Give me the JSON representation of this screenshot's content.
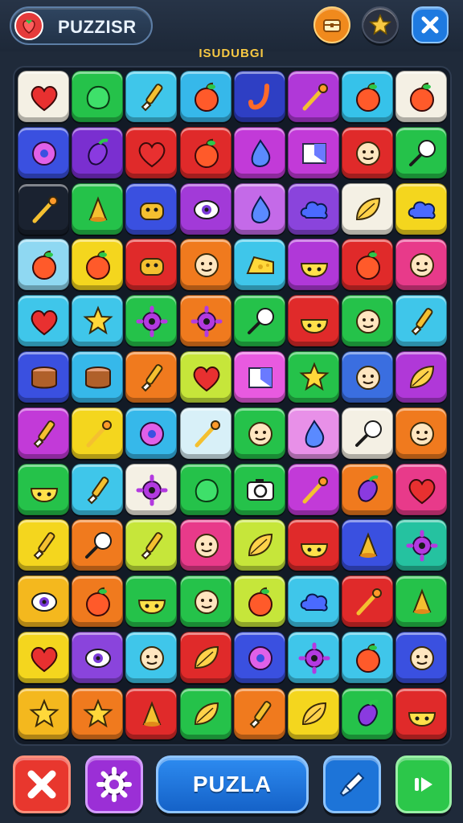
{
  "header": {
    "title": "PUZZISR",
    "logo_icon": "strawberry-icon",
    "buttons": [
      {
        "name": "menu-button",
        "icon": "chest-icon",
        "color": "#f08a1d"
      },
      {
        "name": "star-button",
        "icon": "star-icon",
        "color": "#2b3140"
      },
      {
        "name": "close-button",
        "icon": "close-icon",
        "color": "#1e7ae0"
      }
    ]
  },
  "board": {
    "label": "ISUDUBGI",
    "rows": 12,
    "columns": 8,
    "tiles": [
      [
        {
          "c": "#f4f0e4",
          "i": "heart"
        },
        {
          "c": "#25c24a",
          "i": "blob"
        },
        {
          "c": "#3fc6ea",
          "i": "brush"
        },
        {
          "c": "#36b8ea",
          "i": "apple"
        },
        {
          "c": "#2e3fc4",
          "i": "hook"
        },
        {
          "c": "#b038d8",
          "i": "wand"
        },
        {
          "c": "#36c2ea",
          "i": "apple"
        },
        {
          "c": "#f4f0e4",
          "i": "apple"
        }
      ],
      [
        {
          "c": "#3a50e0",
          "i": "donut"
        },
        {
          "c": "#7a2fd0",
          "i": "eggplant"
        },
        {
          "c": "#e02a2a",
          "i": "heart"
        },
        {
          "c": "#e02a2a",
          "i": "apple"
        },
        {
          "c": "#c23ad8",
          "i": "drop"
        },
        {
          "c": "#c23ad8",
          "i": "cube"
        },
        {
          "c": "#e02a2a",
          "i": "face"
        },
        {
          "c": "#25c24a",
          "i": "lolly"
        }
      ],
      [
        {
          "c": "#1a2230",
          "i": "wand"
        },
        {
          "c": "#25c24a",
          "i": "cone"
        },
        {
          "c": "#3a50e0",
          "i": "creature"
        },
        {
          "c": "#a23ad8",
          "i": "eye"
        },
        {
          "c": "#c46ae8",
          "i": "drop"
        },
        {
          "c": "#8a44dc",
          "i": "cloud"
        },
        {
          "c": "#f4f0e4",
          "i": "leaf"
        },
        {
          "c": "#f4d61e",
          "i": "cloud"
        }
      ],
      [
        {
          "c": "#8fd8f2",
          "i": "apple"
        },
        {
          "c": "#f4d61e",
          "i": "apple"
        },
        {
          "c": "#e02a2a",
          "i": "creature"
        },
        {
          "c": "#f07a1e",
          "i": "face"
        },
        {
          "c": "#3fc6ea",
          "i": "cheese"
        },
        {
          "c": "#b038d8",
          "i": "bowl"
        },
        {
          "c": "#e02a2a",
          "i": "apple"
        },
        {
          "c": "#e83a8a",
          "i": "face"
        }
      ],
      [
        {
          "c": "#3fc6ea",
          "i": "heart"
        },
        {
          "c": "#3fc6ea",
          "i": "star"
        },
        {
          "c": "#25c24a",
          "i": "gear"
        },
        {
          "c": "#f07a1e",
          "i": "gear"
        },
        {
          "c": "#25c24a",
          "i": "lolly"
        },
        {
          "c": "#e02a2a",
          "i": "bowl"
        },
        {
          "c": "#25c24a",
          "i": "face"
        },
        {
          "c": "#3fc6ea",
          "i": "brush"
        }
      ],
      [
        {
          "c": "#3a50e0",
          "i": "drum"
        },
        {
          "c": "#36b8ea",
          "i": "drum"
        },
        {
          "c": "#f07a1e",
          "i": "brush"
        },
        {
          "c": "#c6e63a",
          "i": "heart"
        },
        {
          "c": "#e85ae0",
          "i": "cube"
        },
        {
          "c": "#25c24a",
          "i": "star"
        },
        {
          "c": "#3a6ee0",
          "i": "face"
        },
        {
          "c": "#b038d8",
          "i": "leaf"
        }
      ],
      [
        {
          "c": "#c23ad8",
          "i": "brush"
        },
        {
          "c": "#f4d61e",
          "i": "wand"
        },
        {
          "c": "#36b8ea",
          "i": "donut"
        },
        {
          "c": "#d8f0f8",
          "i": "wand"
        },
        {
          "c": "#25c24a",
          "i": "face"
        },
        {
          "c": "#e890e8",
          "i": "drop"
        },
        {
          "c": "#f4f0e4",
          "i": "lolly"
        },
        {
          "c": "#f07a1e",
          "i": "face"
        }
      ],
      [
        {
          "c": "#25c24a",
          "i": "bowl"
        },
        {
          "c": "#3fc6ea",
          "i": "brush"
        },
        {
          "c": "#f4f0e4",
          "i": "gear"
        },
        {
          "c": "#25c24a",
          "i": "blob"
        },
        {
          "c": "#25c24a",
          "i": "camera"
        },
        {
          "c": "#c23ad8",
          "i": "wand"
        },
        {
          "c": "#f07a1e",
          "i": "eggplant"
        },
        {
          "c": "#e83a8a",
          "i": "heart"
        }
      ],
      [
        {
          "c": "#f4d61e",
          "i": "brush"
        },
        {
          "c": "#f07a1e",
          "i": "lolly"
        },
        {
          "c": "#c6e63a",
          "i": "brush"
        },
        {
          "c": "#e83a8a",
          "i": "face"
        },
        {
          "c": "#c6e63a",
          "i": "leaf"
        },
        {
          "c": "#e02a2a",
          "i": "bowl"
        },
        {
          "c": "#3a50e0",
          "i": "cone"
        },
        {
          "c": "#25c2a0",
          "i": "gear"
        }
      ],
      [
        {
          "c": "#f4b81e",
          "i": "eye"
        },
        {
          "c": "#f07a1e",
          "i": "apple"
        },
        {
          "c": "#25c24a",
          "i": "bowl"
        },
        {
          "c": "#25c24a",
          "i": "face"
        },
        {
          "c": "#c6e63a",
          "i": "apple"
        },
        {
          "c": "#3fc6ea",
          "i": "cloud"
        },
        {
          "c": "#e02a2a",
          "i": "wand"
        },
        {
          "c": "#25c24a",
          "i": "cone"
        }
      ],
      [
        {
          "c": "#f4d61e",
          "i": "heart"
        },
        {
          "c": "#8a44dc",
          "i": "eye"
        },
        {
          "c": "#3fc6ea",
          "i": "face"
        },
        {
          "c": "#e02a2a",
          "i": "leaf"
        },
        {
          "c": "#3a50e0",
          "i": "donut"
        },
        {
          "c": "#3fc6ea",
          "i": "gear"
        },
        {
          "c": "#3fc6ea",
          "i": "apple"
        },
        {
          "c": "#3a50e0",
          "i": "face"
        }
      ],
      [
        {
          "c": "#f4b81e",
          "i": "star"
        },
        {
          "c": "#f07a1e",
          "i": "star"
        },
        {
          "c": "#e02a2a",
          "i": "cone"
        },
        {
          "c": "#25c24a",
          "i": "leaf"
        },
        {
          "c": "#f07a1e",
          "i": "brush"
        },
        {
          "c": "#f4d61e",
          "i": "leaf"
        },
        {
          "c": "#25c24a",
          "i": "eggplant"
        },
        {
          "c": "#e02a2a",
          "i": "bowl"
        }
      ]
    ]
  },
  "footer": {
    "main_label": "PUZLA",
    "buttons": [
      {
        "name": "shuffle-button",
        "icon": "close-icon"
      },
      {
        "name": "settings-button",
        "icon": "gear-icon"
      },
      {
        "name": "tool-button",
        "icon": "wrench-icon"
      },
      {
        "name": "play-button",
        "icon": "play-icon"
      }
    ]
  }
}
